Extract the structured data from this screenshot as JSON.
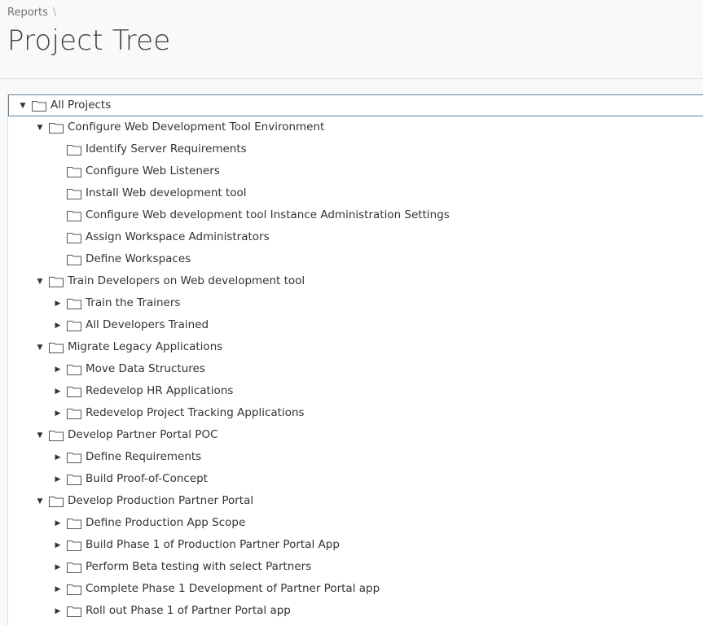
{
  "breadcrumb": {
    "items": [
      "Reports"
    ],
    "separator": "\\"
  },
  "page": {
    "title": "Project Tree"
  },
  "icons": {
    "expanded": "triangle-down-icon",
    "collapsed": "triangle-right-icon",
    "node": "folder-icon"
  },
  "colors": {
    "selection_border": "#5a7f9b",
    "background": "#f9f9f9"
  },
  "tree": {
    "root": {
      "label": "All Projects",
      "state": "expanded"
    },
    "projects": [
      {
        "label": "Configure Web Development Tool Environment",
        "state": "expanded",
        "children": [
          {
            "label": "Identify Server Requirements",
            "state": "leaf"
          },
          {
            "label": "Configure Web Listeners",
            "state": "leaf"
          },
          {
            "label": "Install Web development tool",
            "state": "leaf"
          },
          {
            "label": "Configure Web development tool Instance Administration Settings",
            "state": "leaf"
          },
          {
            "label": "Assign Workspace Administrators",
            "state": "leaf"
          },
          {
            "label": "Define Workspaces",
            "state": "leaf"
          }
        ]
      },
      {
        "label": "Train Developers on Web development tool",
        "state": "expanded",
        "children": [
          {
            "label": "Train the Trainers",
            "state": "collapsed"
          },
          {
            "label": "All Developers Trained",
            "state": "collapsed"
          }
        ]
      },
      {
        "label": "Migrate Legacy Applications",
        "state": "expanded",
        "children": [
          {
            "label": "Move Data Structures",
            "state": "collapsed"
          },
          {
            "label": "Redevelop HR Applications",
            "state": "collapsed"
          },
          {
            "label": "Redevelop Project Tracking Applications",
            "state": "collapsed"
          }
        ]
      },
      {
        "label": "Develop Partner Portal POC",
        "state": "expanded",
        "children": [
          {
            "label": "Define Requirements",
            "state": "collapsed"
          },
          {
            "label": "Build Proof-of-Concept",
            "state": "collapsed"
          }
        ]
      },
      {
        "label": "Develop Production Partner Portal",
        "state": "expanded",
        "children": [
          {
            "label": "Define Production App Scope",
            "state": "collapsed"
          },
          {
            "label": "Build Phase 1 of Production Partner Portal App",
            "state": "collapsed"
          },
          {
            "label": "Perform Beta testing with select Partners",
            "state": "collapsed"
          },
          {
            "label": "Complete Phase 1 Development of Partner Portal app",
            "state": "collapsed"
          },
          {
            "label": "Roll out Phase 1 of Partner Portal app",
            "state": "collapsed"
          }
        ]
      }
    ]
  }
}
